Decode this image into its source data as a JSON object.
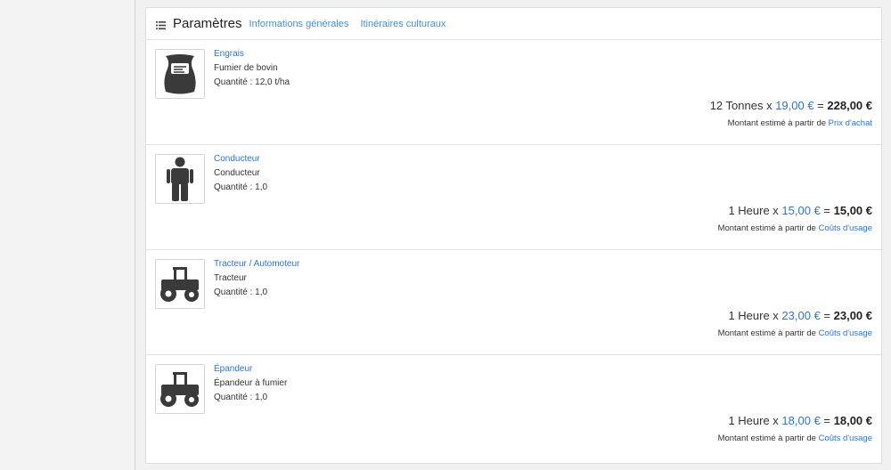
{
  "header": {
    "title": "Paramètres",
    "icon": "list-icon",
    "tabs": [
      "Informations générales",
      "Itinéraires culturaux"
    ]
  },
  "items": [
    {
      "icon": "fertilizer-bag-icon",
      "category": "Engrais",
      "name": "Fumier de bovin",
      "quantity": "Quantité : 12,0 t/ha",
      "price_prefix": "12 Tonnes x ",
      "unit_price": "19,00 €",
      "equals": " = ",
      "total": "228,00 €",
      "estimate_prefix": "Montant estimé à partir de ",
      "estimate_source": "Prix d'achat"
    },
    {
      "icon": "person-icon",
      "category": "Conducteur",
      "name": "Conducteur",
      "quantity": "Quantité : 1,0",
      "price_prefix": "1 Heure x ",
      "unit_price": "15,00 €",
      "equals": " = ",
      "total": "15,00 €",
      "estimate_prefix": "Montant estimé à partir de ",
      "estimate_source": "Coûts d'usage"
    },
    {
      "icon": "tractor-icon",
      "category": "Tracteur / Automoteur",
      "name": "Tracteur",
      "quantity": "Quantité : 1,0",
      "price_prefix": "1 Heure x ",
      "unit_price": "23,00 €",
      "equals": " = ",
      "total": "23,00 €",
      "estimate_prefix": "Montant estimé à partir de ",
      "estimate_source": "Coûts d'usage"
    },
    {
      "icon": "tractor-icon",
      "category": "Épandeur",
      "name": "Épandeur à fumier",
      "quantity": "Quantité : 1,0",
      "price_prefix": "1 Heure x ",
      "unit_price": "18,00 €",
      "equals": " = ",
      "total": "18,00 €",
      "estimate_prefix": "Montant estimé à partir de ",
      "estimate_source": "Coûts d'usage"
    }
  ],
  "colors": {
    "link": "#2f75c9",
    "icon": "#3a3a3a"
  }
}
